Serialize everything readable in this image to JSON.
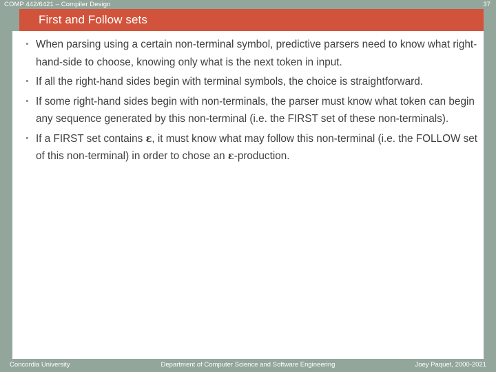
{
  "header": {
    "course": "COMP 442/6421 – Compiler Design",
    "page_number": "37",
    "band_color": "#93a69c"
  },
  "title_bar": {
    "title": "First and Follow sets",
    "background_color": "#d2533c",
    "text_color": "#ffffff"
  },
  "content": {
    "background_color": "#ffffff",
    "text_color": "#3f3f3f",
    "bullet_marker_color": "#9a9a9a",
    "bullets": [
      {
        "segments": [
          {
            "text": "When parsing using a certain non-terminal symbol, predictive parsers need to know what right-hand-side to choose, knowing only what is the next token in input."
          }
        ]
      },
      {
        "segments": [
          {
            "text": "If all the right-hand sides begin with terminal symbols, the choice is straightforward."
          }
        ]
      },
      {
        "segments": [
          {
            "text": "If some right-hand sides begin with non-terminals, the parser must know what token can begin any sequence generated by this non-terminal (i.e. the FIRST set of these non-terminals)."
          }
        ]
      },
      {
        "segments": [
          {
            "text": "If a FIRST set contains "
          },
          {
            "text": "ε",
            "style": "epsilon"
          },
          {
            "text": ", it must know what may follow this non-terminal (i.e. the FOLLOW set of this non-terminal) in order to chose an "
          },
          {
            "text": "ε",
            "style": "epsilon"
          },
          {
            "text": "-production."
          }
        ]
      }
    ]
  },
  "footer": {
    "left": "Concordia University",
    "center": "Department of Computer Science and Software Engineering",
    "right": "Joey Paquet, 2000-2021",
    "background_color": "#93a69c",
    "text_color": "#ffffff"
  }
}
